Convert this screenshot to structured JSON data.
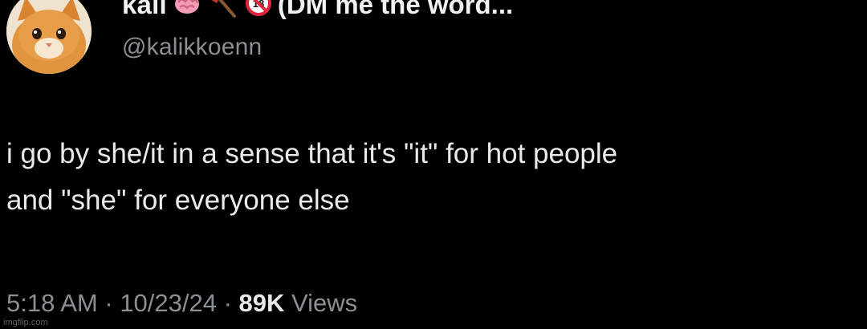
{
  "author": {
    "display_name": "kali",
    "name_suffix": "(DM me the word...",
    "handle": "@kalikkoenn",
    "emojis": [
      "brain-emoji",
      "axe-emoji",
      "no-one-under-eighteen-emoji"
    ],
    "avatar": "orange-cat-avatar"
  },
  "tweet": {
    "line1": "i go by she/it in a sense that it's \"it\" for hot people",
    "line2": "and \"she\" for everyone else"
  },
  "meta": {
    "time": "5:18 AM",
    "sep1": " · ",
    "date": "10/23/24",
    "sep2": " · ",
    "views_count": "89K",
    "views_label": " Views"
  },
  "watermark": "imgflip.com",
  "colors": {
    "background": "#000000",
    "text": "#e7e9ea",
    "muted": "#8b8f94"
  }
}
